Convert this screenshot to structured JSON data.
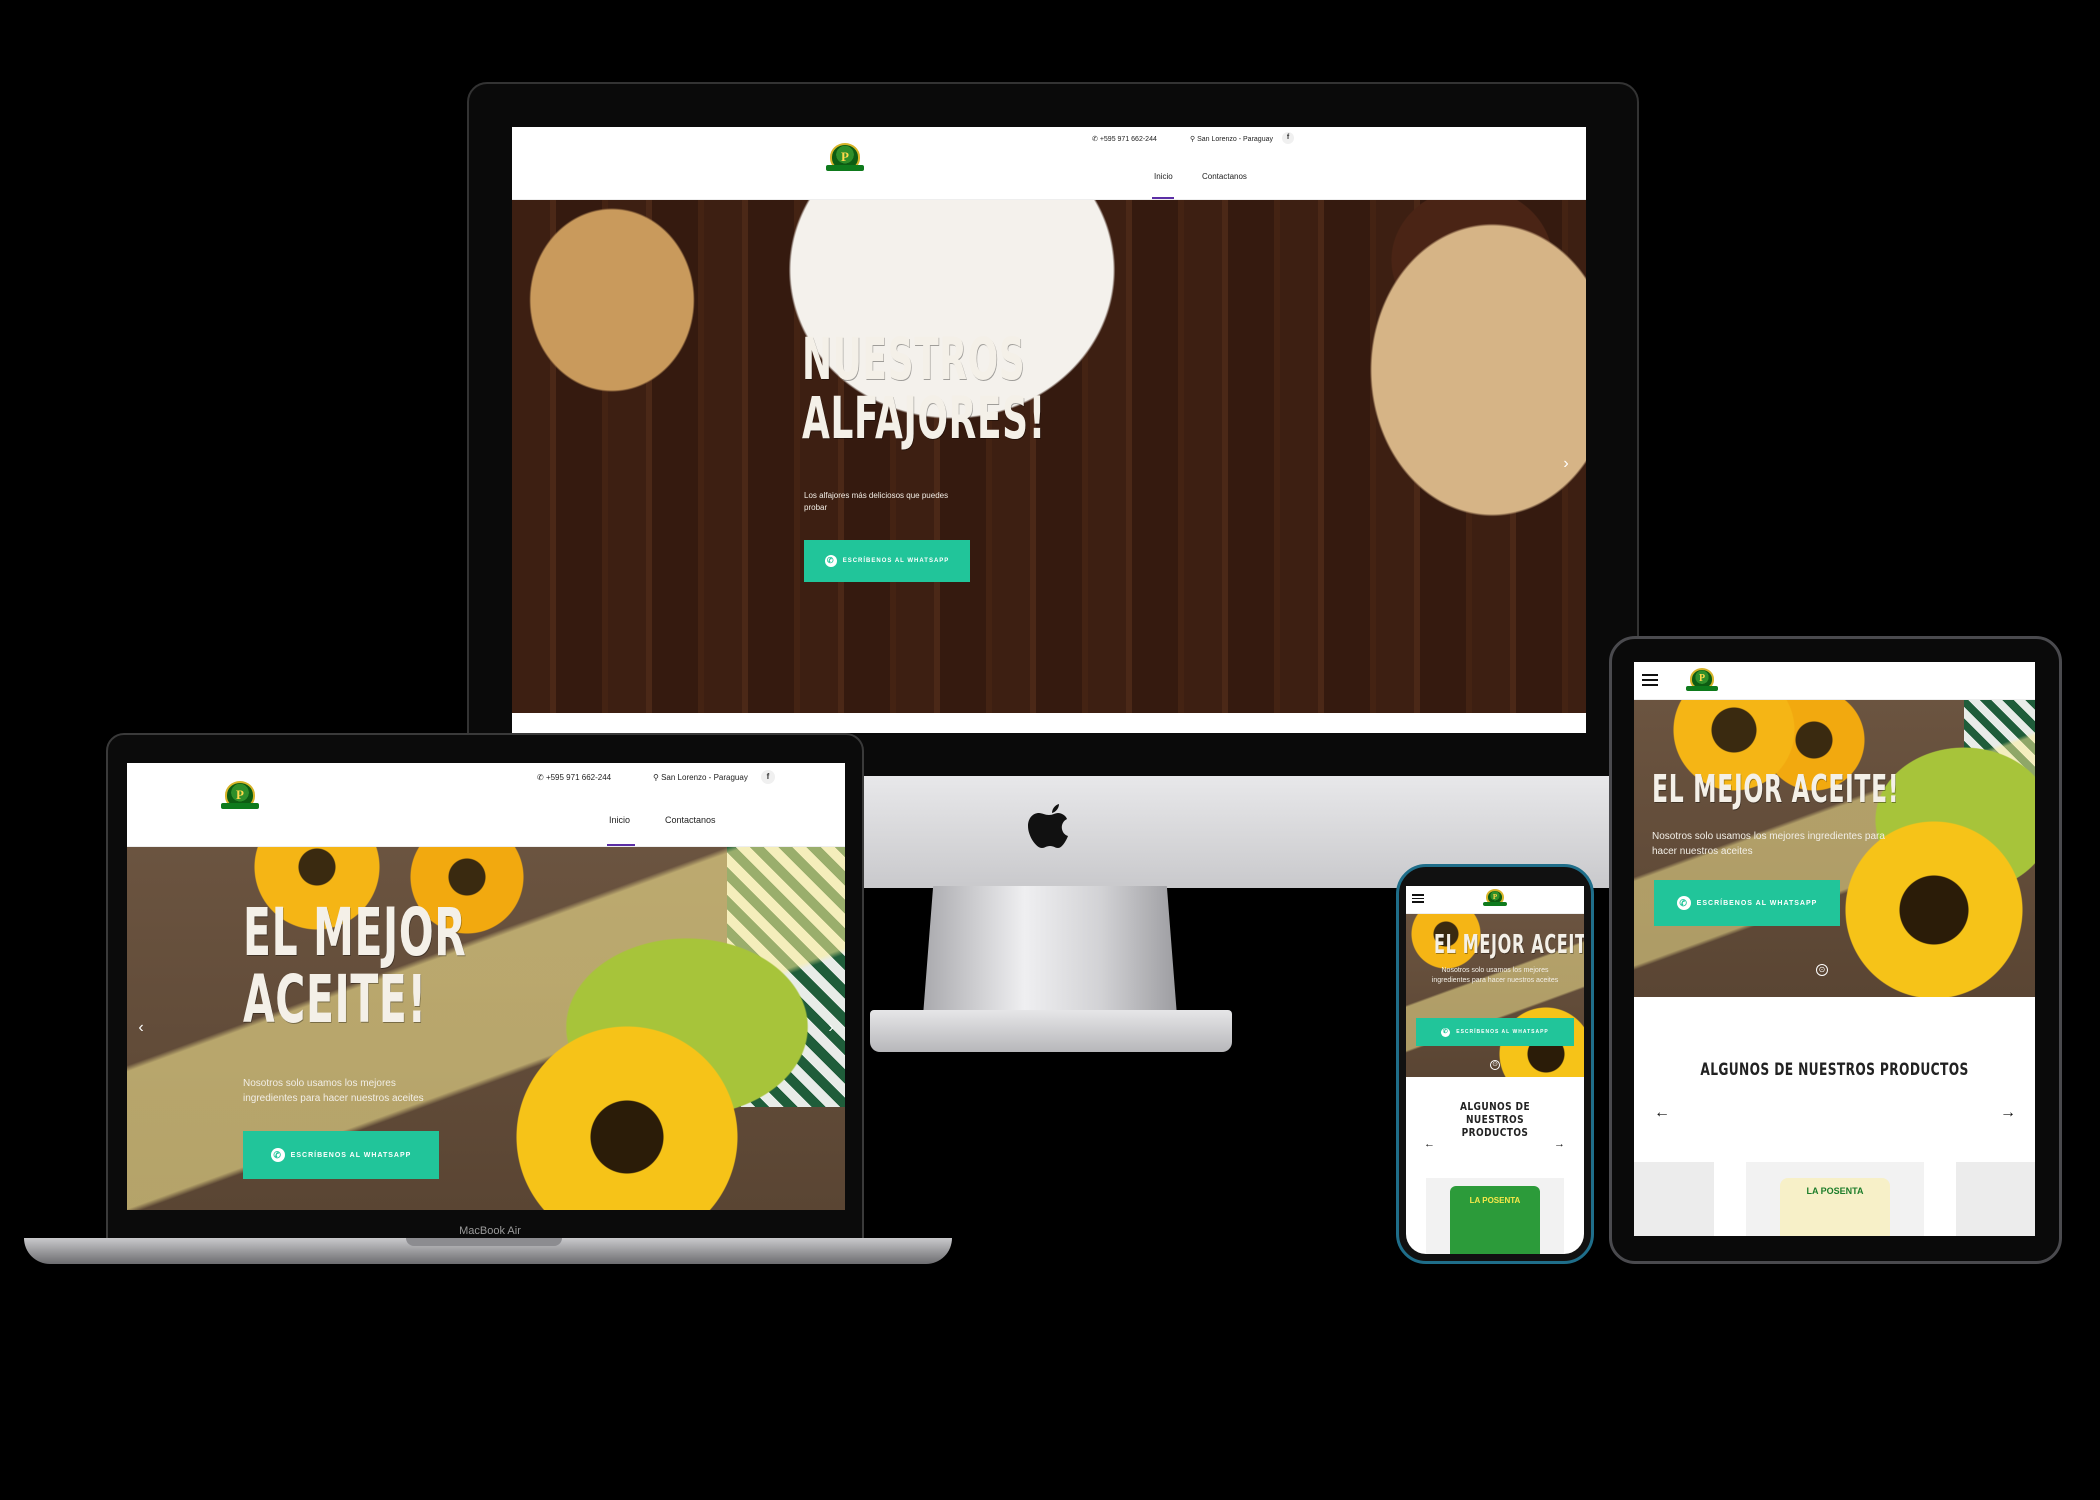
{
  "brand": {
    "logo_letter": "P",
    "macbook_label": "MacBook Air"
  },
  "header": {
    "phone": "+595 971 662-244",
    "location": "San Lorenzo - Paraguay",
    "facebook": "f",
    "nav": [
      {
        "label": "Inicio",
        "active": true
      },
      {
        "label": "Contactanos",
        "active": false
      }
    ]
  },
  "imac_slide": {
    "title_line1": "NUESTROS",
    "title_line2": "ALFAJORES!",
    "subtitle": "Los alfajores más deliciosos que puedes probar",
    "button": "ESCRÍBENOS AL WHATSAPP"
  },
  "laptop_slide": {
    "title_line1": "EL MEJOR",
    "title_line2": "ACEITE!",
    "subtitle": "Nosotros solo usamos los mejores ingredientes para hacer nuestros aceites",
    "button": "ESCRÍBENOS AL WHATSAPP"
  },
  "tablet_slide": {
    "title": "EL MEJOR ACEITE!",
    "subtitle": "Nosotros solo usamos los mejores ingredientes para hacer nuestros aceites",
    "button": "ESCRÍBENOS AL WHATSAPP"
  },
  "phone_slide": {
    "title": "EL MEJOR ACEITE!",
    "subtitle": "Nosotros solo usamos los mejores ingredientes para hacer nuestros aceites",
    "button": "ESCRÍBENOS AL WHATSAPP"
  },
  "products": {
    "title": "ALGUNOS DE NUESTROS PRODUCTOS",
    "item_label": "LA POSENTA"
  },
  "icons": {
    "whatsapp": "✆",
    "location": "⚲",
    "prev": "←",
    "next": "→",
    "slide_prev": "‹",
    "slide_next": "›",
    "dot": "⊙"
  },
  "colors": {
    "accent": "#5b2ea5",
    "whatsapp_button": "#21c59a",
    "logo_green": "#0d5c12"
  }
}
